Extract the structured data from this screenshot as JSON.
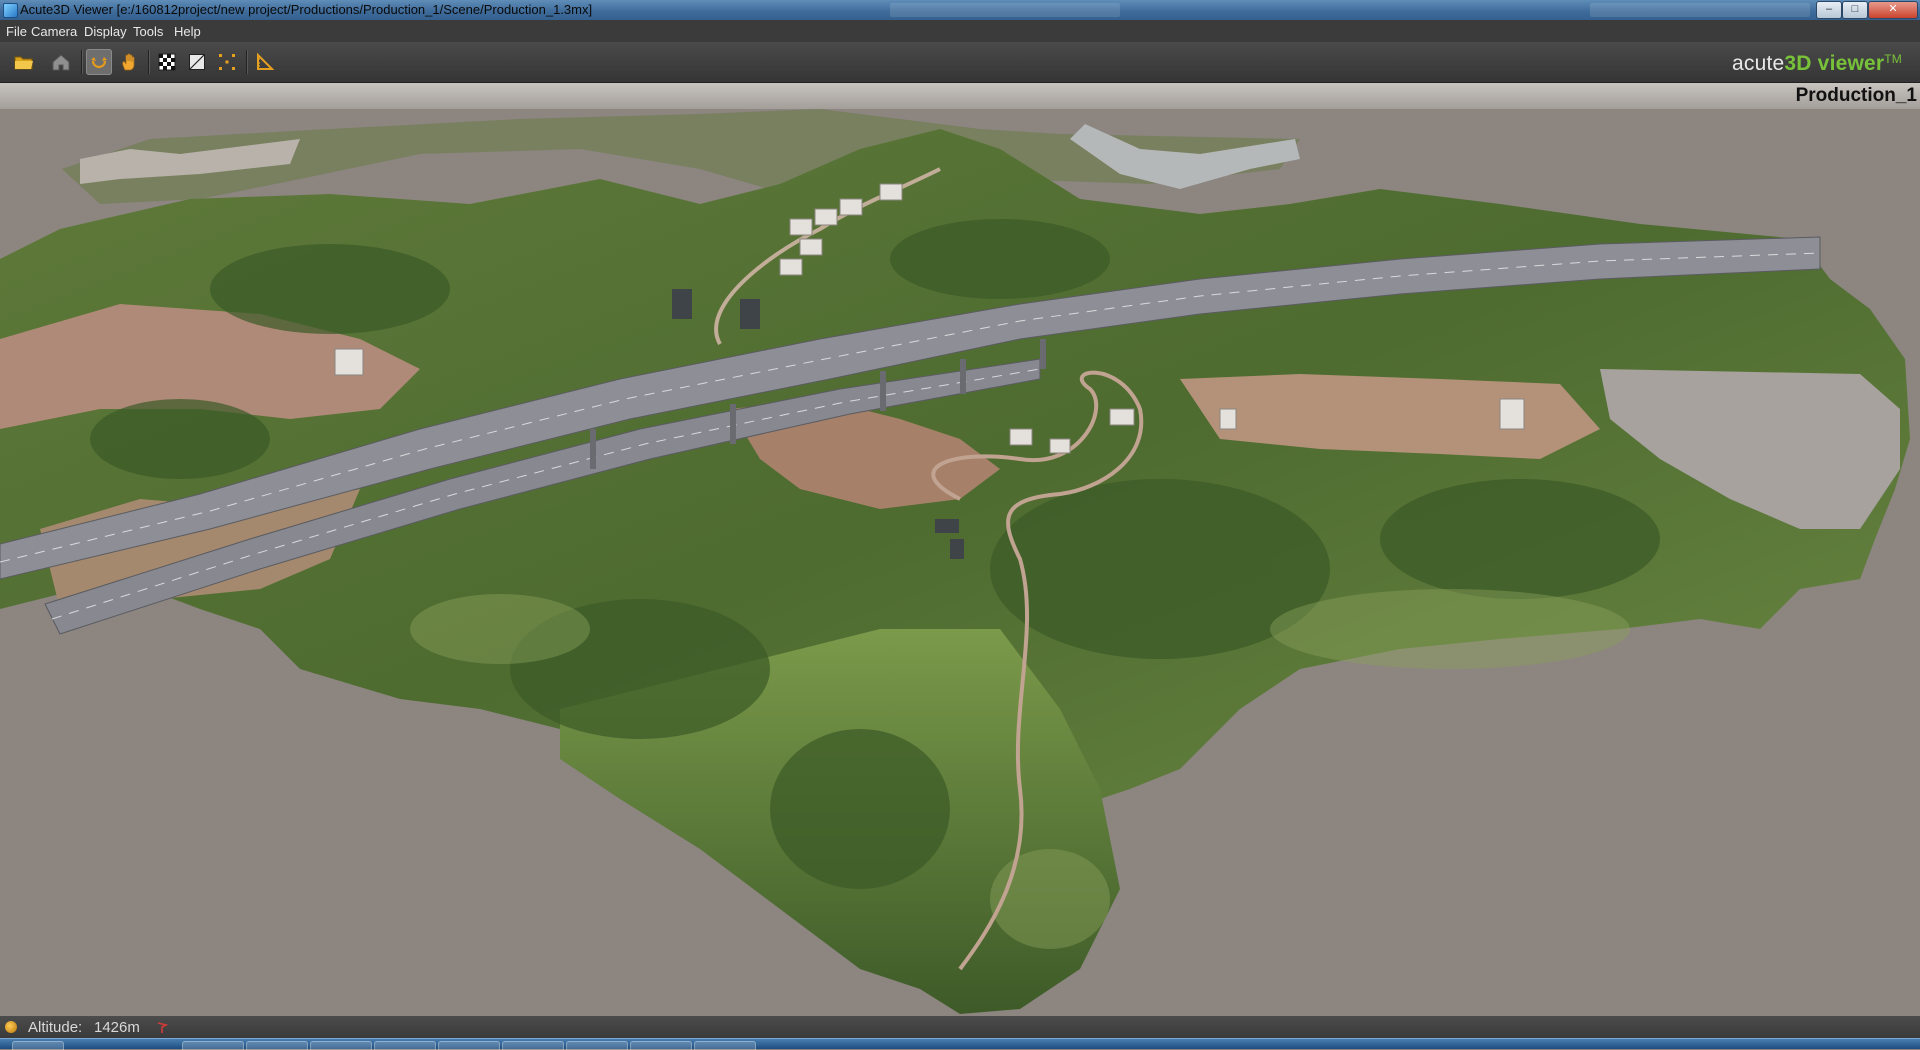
{
  "window": {
    "title": "Acute3D Viewer [e:/160812project/new project/Productions/Production_1/Scene/Production_1.3mx]",
    "controls": {
      "minimize": "–",
      "maximize": "□",
      "close": "✕"
    }
  },
  "menu": {
    "items": [
      "File",
      "Camera",
      "Display",
      "Tools",
      "Help"
    ]
  },
  "toolbar": {
    "tools": [
      {
        "id": "open",
        "icon": "folder-icon"
      },
      {
        "id": "home",
        "icon": "home-icon"
      },
      {
        "id": "rotate",
        "icon": "rotate-icon",
        "active": true
      },
      {
        "id": "pan",
        "icon": "hand-icon"
      },
      {
        "id": "texture",
        "icon": "checkerboard-icon"
      },
      {
        "id": "wireframe",
        "icon": "wireframe-icon"
      },
      {
        "id": "bounds",
        "icon": "bounding-box-icon"
      },
      {
        "id": "measure",
        "icon": "ruler-icon"
      }
    ],
    "brand": {
      "prefix": "acute",
      "highlight": "3D viewer",
      "tm": "TM"
    }
  },
  "scene": {
    "production_label": "Production_1"
  },
  "status": {
    "altitude_label": "Altitude:",
    "altitude_value": "1426m"
  },
  "colors": {
    "accent_green": "#78c23a",
    "background": "#8c8580"
  }
}
